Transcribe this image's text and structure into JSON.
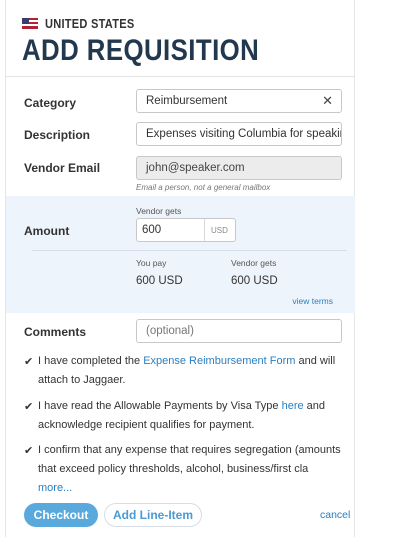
{
  "header": {
    "country": "UNITED STATES",
    "title": "ADD REQUISITION"
  },
  "form": {
    "category": {
      "label": "Category",
      "value": "Reimbursement"
    },
    "description": {
      "label": "Description",
      "value": "Expenses visiting Columbia for speaking e"
    },
    "vendor_email": {
      "label": "Vendor Email",
      "value": "john@speaker.com",
      "hint": "Email a person, not a general mailbox"
    },
    "amount": {
      "label": "Amount",
      "vendor_gets_label": "Vendor gets",
      "value": "600",
      "currency": "USD",
      "you_pay_label": "You pay",
      "you_pay_value": "600  USD",
      "vendor_gets_label_2": "Vendor gets",
      "vendor_gets_value": "600  USD",
      "view_terms": "view terms"
    },
    "comments": {
      "label": "Comments",
      "placeholder": "(optional)"
    }
  },
  "checks": [
    {
      "pre": "I have completed the ",
      "link": "Expense Reimbursement Form",
      "post": " and will attach to Jaggaer."
    },
    {
      "pre": "I have read the Allowable Payments by Visa Type ",
      "link": "here",
      "post": " and acknowledge recipient qualifies for payment."
    },
    {
      "pre": "I confirm that any expense that requires segregation (amounts that exceed policy thresholds, alcohol, business/first cla",
      "link": "more...",
      "post": ""
    }
  ],
  "actions": {
    "checkout": "Checkout",
    "add_line_item": "Add Line-Item",
    "cancel": "cancel"
  },
  "colors": {
    "title": "#22384f",
    "link": "#2a7fc1",
    "primary_button": "#5aa9dd",
    "amount_panel": "#eef4fb"
  }
}
